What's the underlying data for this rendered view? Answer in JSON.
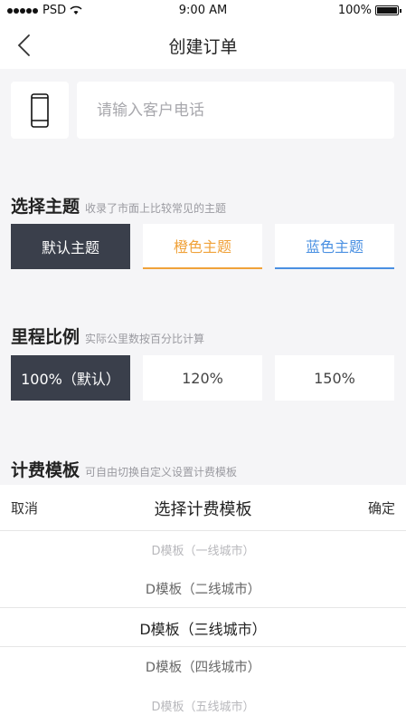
{
  "status": {
    "carrier": "PSD",
    "time": "9:00 AM",
    "battery": "100%"
  },
  "nav": {
    "title": "创建订单"
  },
  "phone": {
    "placeholder": "请输入客户电话",
    "value": ""
  },
  "theme": {
    "title": "选择主题",
    "subtitle": "收录了市面上比较常见的主题",
    "options": [
      "默认主题",
      "橙色主题",
      "蓝色主题"
    ],
    "colors": {
      "default": "#3a3f4b",
      "orange": "#f0a23a",
      "blue": "#4a90e2"
    }
  },
  "mileage": {
    "title": "里程比例",
    "subtitle": "实际公里数按百分比计算",
    "options": [
      "100%（默认）",
      "120%",
      "150%"
    ]
  },
  "billing": {
    "title": "计费模板",
    "subtitle": "可自由切换自定义设置计费模板"
  },
  "picker": {
    "cancel": "取消",
    "title": "选择计费模板",
    "confirm": "确定",
    "items": [
      "D模板（一线城市）",
      "D模板（二线城市）",
      "D模板（三线城市）",
      "D模板（四线城市）",
      "D模板（五线城市）"
    ],
    "selected_index": 2
  }
}
